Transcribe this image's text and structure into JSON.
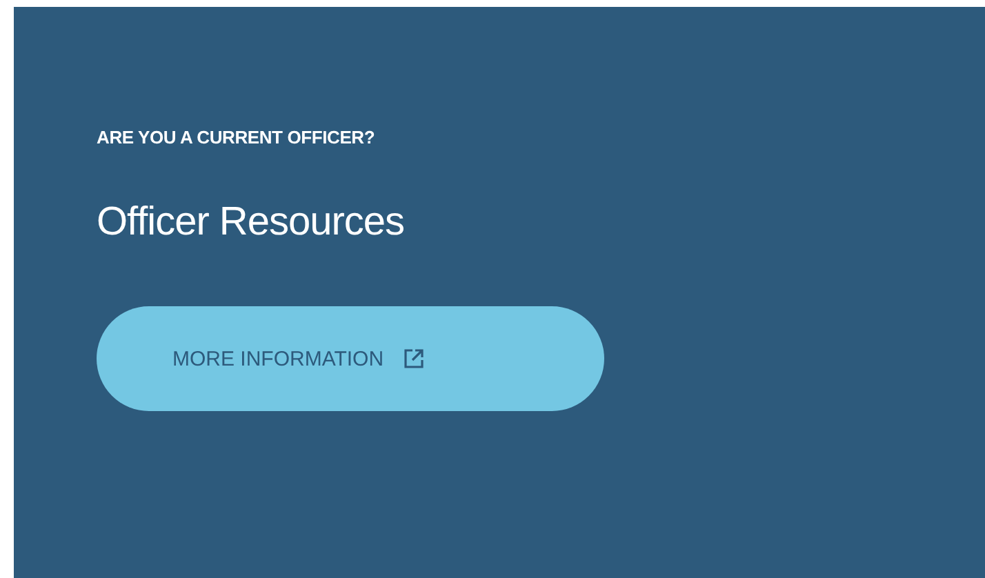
{
  "promo": {
    "eyebrow": "ARE YOU A CURRENT OFFICER?",
    "title": "Officer Resources",
    "button": {
      "label": "MORE INFORMATION",
      "external": true
    }
  }
}
